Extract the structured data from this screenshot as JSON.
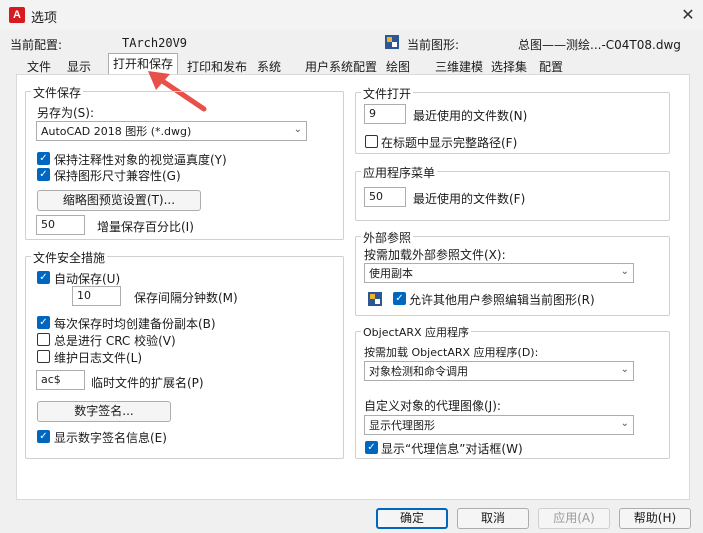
{
  "window": {
    "app_icon_letter": "A",
    "title": "选项",
    "close_glyph": "✕"
  },
  "header": {
    "profile_label": "当前配置:",
    "profile_value": "TArch20V9",
    "drawing_label": "当前图形:",
    "drawing_value": "总图——测绘...-C04T08.dwg"
  },
  "tabs": [
    "文件",
    "显示",
    "打开和保存",
    "打印和发布",
    "系统",
    "用户系统配置",
    "绘图",
    "三维建模",
    "选择集",
    "配置"
  ],
  "active_tab_index": 2,
  "file_save": {
    "title": "文件保存",
    "save_as_label": "另存为(S):",
    "save_as_value": "AutoCAD 2018 图形 (*.dwg)",
    "maintain_visual_fidelity": {
      "label": "保持注释性对象的视觉逼真度(Y)",
      "checked": true
    },
    "maintain_drawing_size": {
      "label": "保持图形尺寸兼容性(G)",
      "checked": true
    },
    "thumbnail_button": "缩略图预览设置(T)...",
    "incremental_value": "50",
    "incremental_label": "增量保存百分比(I)"
  },
  "file_safety": {
    "title": "文件安全措施",
    "autosave": {
      "label": "自动保存(U)",
      "checked": true
    },
    "autosave_minutes_value": "10",
    "autosave_minutes_label": "保存间隔分钟数(M)",
    "backup_copy": {
      "label": "每次保存时均创建备份副本(B)",
      "checked": true
    },
    "crc_check": {
      "label": "总是进行 CRC 校验(V)",
      "checked": false
    },
    "log_file": {
      "label": "维护日志文件(L)",
      "checked": false
    },
    "temp_ext_value": "ac$",
    "temp_ext_label": "临时文件的扩展名(P)",
    "digital_sign_button": "数字签名...",
    "show_sign_info": {
      "label": "显示数字签名信息(E)",
      "checked": true
    }
  },
  "file_open": {
    "title": "文件打开",
    "recent_value": "9",
    "recent_label": "最近使用的文件数(N)",
    "full_path": {
      "label": "在标题中显示完整路径(F)",
      "checked": false
    }
  },
  "app_menu": {
    "title": "应用程序菜单",
    "recent_value": "50",
    "recent_label": "最近使用的文件数(F)"
  },
  "xref": {
    "title": "外部参照",
    "demand_load_label": "按需加载外部参照文件(X):",
    "demand_load_value": "使用副本",
    "allow_edit": {
      "label": "允许其他用户参照编辑当前图形(R)",
      "checked": true
    }
  },
  "objectarx": {
    "title": "ObjectARX 应用程序",
    "demand_load_label": "按需加载 ObjectARX 应用程序(D):",
    "demand_load_value": "对象检测和命令调用",
    "proxy_images_label": "自定义对象的代理图像(J):",
    "proxy_images_value": "显示代理图形",
    "show_proxy_dialog": {
      "label": "显示“代理信息”对话框(W)",
      "checked": true
    }
  },
  "buttons": {
    "ok": "确定",
    "cancel": "取消",
    "apply": "应用(A)",
    "help": "帮助(H)"
  },
  "colors": {
    "accent": "#0067c0",
    "arrow": "#e8504a"
  }
}
